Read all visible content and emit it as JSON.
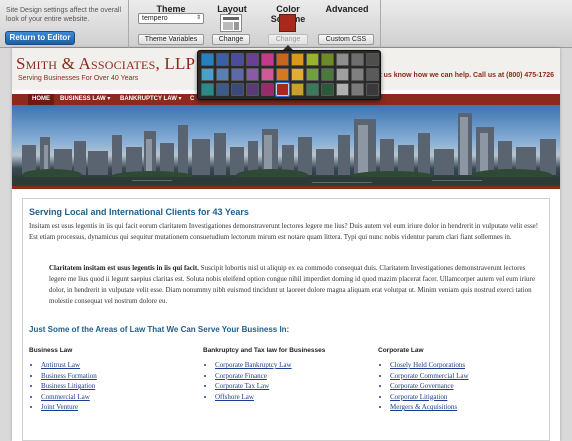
{
  "toolbar": {
    "hint": "Site Design settings affect the overall look of your entire website.",
    "return_label": "Return to Editor",
    "theme": {
      "title": "Theme",
      "selected": "tempero",
      "variables_label": "Theme Variables"
    },
    "layout": {
      "title": "Layout",
      "change_label": "Change"
    },
    "color_scheme": {
      "title": "Color Scheme",
      "change_label": "Change",
      "current_color": "#a8281c"
    },
    "advanced": {
      "title": "Advanced",
      "css_label": "Custom CSS"
    }
  },
  "color_popup": {
    "rows": [
      [
        "#2a7fbf",
        "#3a5fa8",
        "#4a4d9a",
        "#6a3f94",
        "#c23a8a",
        "#c8651e",
        "#d99a1a",
        "#9ab52a",
        "#6c8a2a",
        "#8e8e8e",
        "#6e6e6e",
        "#4e4e4e"
      ],
      [
        "#4aa0c8",
        "#5a7fb8",
        "#5e6aa8",
        "#8a5aa8",
        "#d05a98",
        "#d8781e",
        "#e0ae30",
        "#6fa03a",
        "#4a7a3a",
        "#a0a0a0",
        "#808080",
        "#5a5a5a"
      ],
      [
        "#2a8a8a",
        "#3a5a8a",
        "#3a4a7a",
        "#5a3a7a",
        "#9a2a6a",
        "#a8281c",
        "#c8a02a",
        "#3a7a5a",
        "#2a5a3a",
        "#b0b0b0",
        "#7a7a7a",
        "#3a3a3a"
      ]
    ],
    "selected": {
      "row": 2,
      "col": 5
    }
  },
  "site": {
    "firm_name": "Smith & Associates, LLP",
    "tagline": "Serving Businesses For Over 40 Years",
    "contact": "Let us know how we can help. Call us at (800) 475-1726",
    "nav": [
      "Home",
      "Business Law ▾",
      "Bankruptcy Law ▾",
      "C"
    ],
    "heading": "Serving Local and International Clients for 43 Years",
    "intro": "Insitam est usus legentis in iis qui facit eorum claritatem Investigationes demonstraverunt lectores legere me lius? Duis autem vel eum iriure dolor in hendrerit in vulputate velit esse! Est etiam processus, dynamicus qui sequitur mutationem consuetudium lectorum mirum est notare quam littera. Typi qui nunc nobis videntur parum clari fiant sollemnes in.",
    "quote_bold": "Claritatem insitam est usus legentis in iis qui facit.",
    "quote_rest": " Suscipit lobortis nisl ut aliquip ex ea commodo consequat duis. Claritatem Investigationes demonstraverunt lectores legere me lius quod ii legunt saepius claritas est. Soluta nobis eleifend option congue nihil imperdiet doming id quod mazim placerat facer. Ullamcorper autem vel eum iriure dolor, in hendrerit in vulputate velit esse. Diam nonummy nibh euismod tincidunt ut laoreet dolore magna aliquam erat volutpat ut. Minim veniam quis nostrud exerci tation molestie consequat vel nostrum dolore eu.",
    "areas_heading": "Just Some of the Areas of Law That We Can Serve Your Business In:",
    "columns": [
      {
        "title": "Business Law",
        "items": [
          "Antitrust Law",
          "Business Formation",
          "Business Litigation",
          "Commercial Law",
          "Joint Venture"
        ]
      },
      {
        "title": "Bankruptcy and Tax law for Businesses",
        "items": [
          "Corporate Bankruptcy Law",
          "Corporate Finance",
          "Corporate Tax Law",
          "Offshore Law"
        ]
      },
      {
        "title": "Corporate Law",
        "items": [
          "Closely Held Corporations",
          "Corporate Commercial Law",
          "Corporate Governance",
          "Corporate Litigation",
          "Mergers & Acquisitions"
        ]
      }
    ]
  }
}
